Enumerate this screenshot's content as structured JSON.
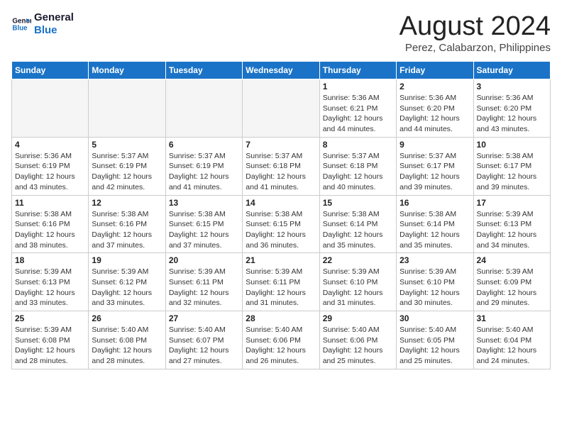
{
  "logo": {
    "line1": "General",
    "line2": "Blue"
  },
  "title": "August 2024",
  "location": "Perez, Calabarzon, Philippines",
  "days_of_week": [
    "Sunday",
    "Monday",
    "Tuesday",
    "Wednesday",
    "Thursday",
    "Friday",
    "Saturday"
  ],
  "weeks": [
    [
      {
        "day": "",
        "info": ""
      },
      {
        "day": "",
        "info": ""
      },
      {
        "day": "",
        "info": ""
      },
      {
        "day": "",
        "info": ""
      },
      {
        "day": "1",
        "info": "Sunrise: 5:36 AM\nSunset: 6:21 PM\nDaylight: 12 hours\nand 44 minutes."
      },
      {
        "day": "2",
        "info": "Sunrise: 5:36 AM\nSunset: 6:20 PM\nDaylight: 12 hours\nand 44 minutes."
      },
      {
        "day": "3",
        "info": "Sunrise: 5:36 AM\nSunset: 6:20 PM\nDaylight: 12 hours\nand 43 minutes."
      }
    ],
    [
      {
        "day": "4",
        "info": "Sunrise: 5:36 AM\nSunset: 6:19 PM\nDaylight: 12 hours\nand 43 minutes."
      },
      {
        "day": "5",
        "info": "Sunrise: 5:37 AM\nSunset: 6:19 PM\nDaylight: 12 hours\nand 42 minutes."
      },
      {
        "day": "6",
        "info": "Sunrise: 5:37 AM\nSunset: 6:19 PM\nDaylight: 12 hours\nand 41 minutes."
      },
      {
        "day": "7",
        "info": "Sunrise: 5:37 AM\nSunset: 6:18 PM\nDaylight: 12 hours\nand 41 minutes."
      },
      {
        "day": "8",
        "info": "Sunrise: 5:37 AM\nSunset: 6:18 PM\nDaylight: 12 hours\nand 40 minutes."
      },
      {
        "day": "9",
        "info": "Sunrise: 5:37 AM\nSunset: 6:17 PM\nDaylight: 12 hours\nand 39 minutes."
      },
      {
        "day": "10",
        "info": "Sunrise: 5:38 AM\nSunset: 6:17 PM\nDaylight: 12 hours\nand 39 minutes."
      }
    ],
    [
      {
        "day": "11",
        "info": "Sunrise: 5:38 AM\nSunset: 6:16 PM\nDaylight: 12 hours\nand 38 minutes."
      },
      {
        "day": "12",
        "info": "Sunrise: 5:38 AM\nSunset: 6:16 PM\nDaylight: 12 hours\nand 37 minutes."
      },
      {
        "day": "13",
        "info": "Sunrise: 5:38 AM\nSunset: 6:15 PM\nDaylight: 12 hours\nand 37 minutes."
      },
      {
        "day": "14",
        "info": "Sunrise: 5:38 AM\nSunset: 6:15 PM\nDaylight: 12 hours\nand 36 minutes."
      },
      {
        "day": "15",
        "info": "Sunrise: 5:38 AM\nSunset: 6:14 PM\nDaylight: 12 hours\nand 35 minutes."
      },
      {
        "day": "16",
        "info": "Sunrise: 5:38 AM\nSunset: 6:14 PM\nDaylight: 12 hours\nand 35 minutes."
      },
      {
        "day": "17",
        "info": "Sunrise: 5:39 AM\nSunset: 6:13 PM\nDaylight: 12 hours\nand 34 minutes."
      }
    ],
    [
      {
        "day": "18",
        "info": "Sunrise: 5:39 AM\nSunset: 6:13 PM\nDaylight: 12 hours\nand 33 minutes."
      },
      {
        "day": "19",
        "info": "Sunrise: 5:39 AM\nSunset: 6:12 PM\nDaylight: 12 hours\nand 33 minutes."
      },
      {
        "day": "20",
        "info": "Sunrise: 5:39 AM\nSunset: 6:11 PM\nDaylight: 12 hours\nand 32 minutes."
      },
      {
        "day": "21",
        "info": "Sunrise: 5:39 AM\nSunset: 6:11 PM\nDaylight: 12 hours\nand 31 minutes."
      },
      {
        "day": "22",
        "info": "Sunrise: 5:39 AM\nSunset: 6:10 PM\nDaylight: 12 hours\nand 31 minutes."
      },
      {
        "day": "23",
        "info": "Sunrise: 5:39 AM\nSunset: 6:10 PM\nDaylight: 12 hours\nand 30 minutes."
      },
      {
        "day": "24",
        "info": "Sunrise: 5:39 AM\nSunset: 6:09 PM\nDaylight: 12 hours\nand 29 minutes."
      }
    ],
    [
      {
        "day": "25",
        "info": "Sunrise: 5:39 AM\nSunset: 6:08 PM\nDaylight: 12 hours\nand 28 minutes."
      },
      {
        "day": "26",
        "info": "Sunrise: 5:40 AM\nSunset: 6:08 PM\nDaylight: 12 hours\nand 28 minutes."
      },
      {
        "day": "27",
        "info": "Sunrise: 5:40 AM\nSunset: 6:07 PM\nDaylight: 12 hours\nand 27 minutes."
      },
      {
        "day": "28",
        "info": "Sunrise: 5:40 AM\nSunset: 6:06 PM\nDaylight: 12 hours\nand 26 minutes."
      },
      {
        "day": "29",
        "info": "Sunrise: 5:40 AM\nSunset: 6:06 PM\nDaylight: 12 hours\nand 25 minutes."
      },
      {
        "day": "30",
        "info": "Sunrise: 5:40 AM\nSunset: 6:05 PM\nDaylight: 12 hours\nand 25 minutes."
      },
      {
        "day": "31",
        "info": "Sunrise: 5:40 AM\nSunset: 6:04 PM\nDaylight: 12 hours\nand 24 minutes."
      }
    ]
  ]
}
